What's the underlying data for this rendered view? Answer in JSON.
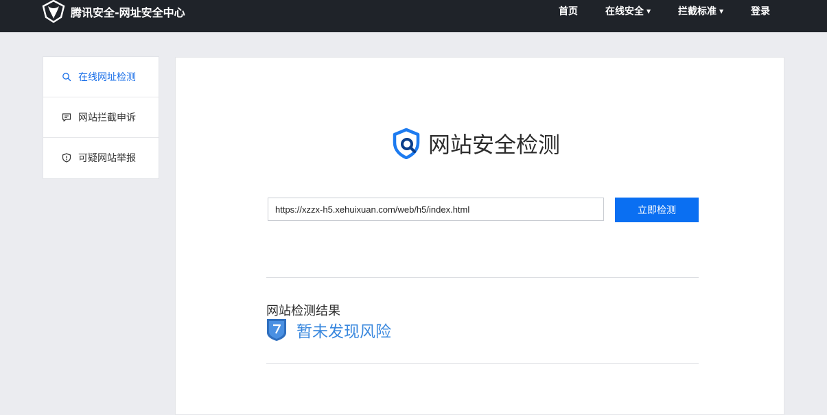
{
  "header": {
    "brand_title": "腾讯安全-网址安全中心",
    "nav": {
      "home": "首页",
      "online_security": "在线安全",
      "block_standard": "拦截标准",
      "login": "登录"
    }
  },
  "sidebar": {
    "items": [
      {
        "label": "在线网址检测",
        "icon": "search-icon",
        "active": true
      },
      {
        "label": "网站拦截申诉",
        "icon": "comment-icon",
        "active": false
      },
      {
        "label": "可疑网站举报",
        "icon": "shield-icon",
        "active": false
      }
    ]
  },
  "main": {
    "title": "网站安全检测",
    "url_input": {
      "value": "https://xzzx-h5.xehuixuan.com/web/h5/index.html"
    },
    "check_button": "立即检测",
    "result": {
      "label": "网站检测结果",
      "status": "暂未发现风险"
    }
  },
  "colors": {
    "topbar_bg": "#1f2329",
    "accent": "#0a6ff2",
    "status_text": "#3a88de",
    "page_bg": "#ebecf0"
  }
}
